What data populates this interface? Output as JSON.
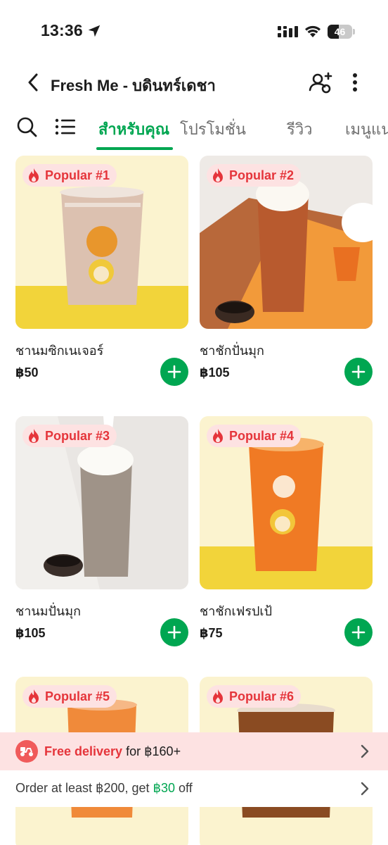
{
  "status_bar": {
    "time": "13:36",
    "battery": "46",
    "battery_level": 0.46
  },
  "header": {
    "title": "Fresh Me - บดินทร์เดชา"
  },
  "tabs": [
    {
      "label": "สำหรับคุณ",
      "active": true
    },
    {
      "label": "โปรโมชั่น",
      "active": false
    },
    {
      "label": "รีวิว",
      "active": false
    },
    {
      "label": "เมนูแน",
      "active": false
    }
  ],
  "colors": {
    "accent_green": "#00a651",
    "badge_red": "#e5353b",
    "badge_bg": "#fde2e2"
  },
  "products": [
    {
      "badge": "Popular #1",
      "name": "ชานมซิกเนเจอร์",
      "price": "฿50"
    },
    {
      "badge": "Popular #2",
      "name": "ชาชักปั่นมุก",
      "price": "฿105"
    },
    {
      "badge": "Popular #3",
      "name": "ชานมปั่นมุก",
      "price": "฿105"
    },
    {
      "badge": "Popular #4",
      "name": "ชาชักเฟรปเป้",
      "price": "฿75"
    },
    {
      "badge": "Popular #5",
      "name": "",
      "price": ""
    },
    {
      "badge": "Popular #6",
      "name": "",
      "price": ""
    }
  ],
  "delivery_banner": {
    "highlight": "Free delivery",
    "rest": " for ฿160+"
  },
  "promo": {
    "prefix": "Order at least ฿200, get ",
    "amount": "฿30",
    "suffix": " off"
  }
}
